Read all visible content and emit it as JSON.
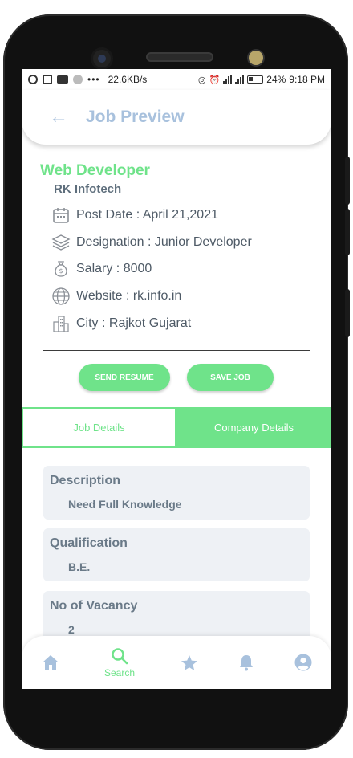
{
  "status_bar": {
    "speed": "22.6KB/s",
    "battery": "24%",
    "time": "9:18 PM"
  },
  "appbar": {
    "title": "Job Preview",
    "back_icon": "arrow-left-icon"
  },
  "job": {
    "title": "Web Developer",
    "company": "RK Infotech",
    "post_date": "Post Date : April 21,2021",
    "designation": "Designation : Junior Developer",
    "salary": "Salary : 8000",
    "website": "Website : rk.info.in",
    "city": "City : Rajkot Gujarat"
  },
  "actions": {
    "send_resume": "SEND RESUME",
    "save_job": "SAVE JOB"
  },
  "tabs": {
    "active": "Job Details",
    "inactive": "Company Details"
  },
  "details": [
    {
      "label": "Description",
      "value": "Need Full Knowledge"
    },
    {
      "label": "Qualification",
      "value": "B.E."
    },
    {
      "label": "No of Vacancy",
      "value": "2"
    }
  ],
  "nav": {
    "search_label": "Search"
  },
  "colors": {
    "accent": "#6fe38a",
    "title": "#a8c1dd",
    "text": "#4e5a66",
    "card": "#eef1f5"
  }
}
